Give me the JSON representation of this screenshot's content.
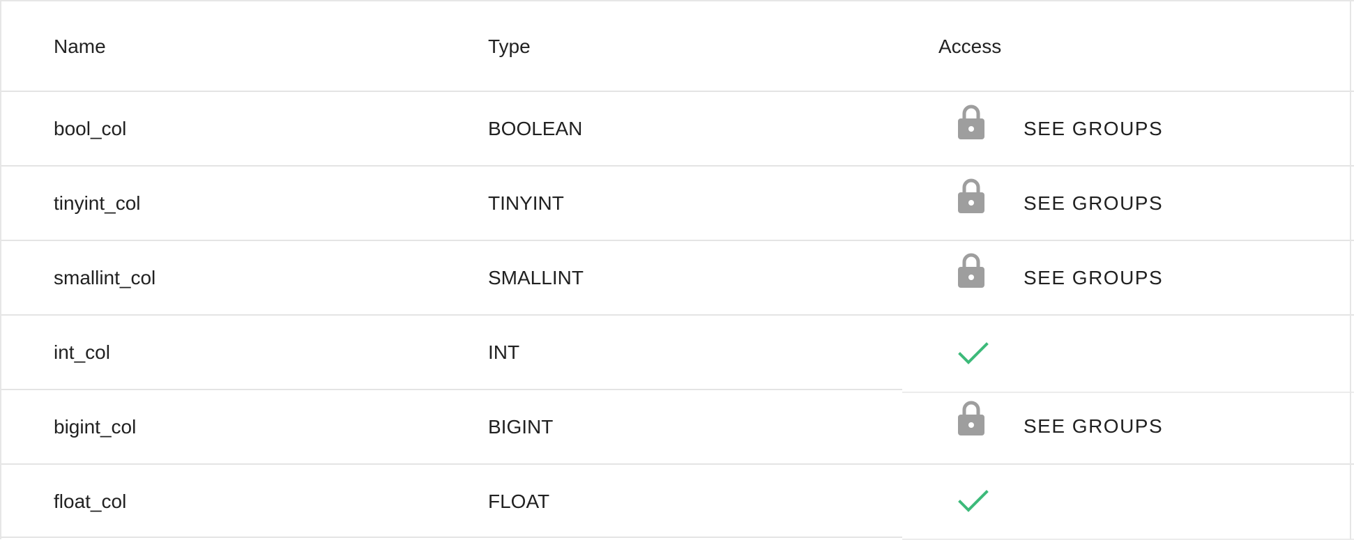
{
  "table": {
    "headers": {
      "name": "Name",
      "type": "Type",
      "access": "Access"
    },
    "rows": [
      {
        "name": "bool_col",
        "type": "BOOLEAN",
        "access_icon": "lock-icon",
        "action_label": "SEE GROUPS"
      },
      {
        "name": "tinyint_col",
        "type": "TINYINT",
        "access_icon": "lock-icon",
        "action_label": "SEE GROUPS"
      },
      {
        "name": "smallint_col",
        "type": "SMALLINT",
        "access_icon": "lock-icon",
        "action_label": "SEE GROUPS"
      },
      {
        "name": "int_col",
        "type": "INT",
        "access_icon": "check-icon",
        "action_label": null
      },
      {
        "name": "bigint_col",
        "type": "BIGINT",
        "access_icon": "lock-icon",
        "action_label": "SEE GROUPS"
      },
      {
        "name": "float_col",
        "type": "FLOAT",
        "access_icon": "check-icon",
        "action_label": null
      }
    ]
  },
  "colors": {
    "lock": "#9e9e9e",
    "check": "#3dba7a",
    "divider": "#e4e4e4"
  }
}
